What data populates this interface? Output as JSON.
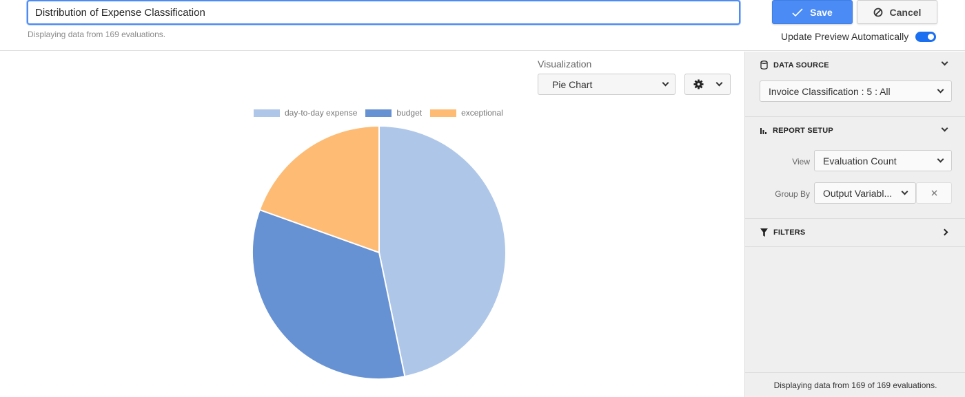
{
  "header": {
    "title_value": "Distribution of Expense Classification",
    "subtitle": "Displaying data from 169 evaluations.",
    "save_label": "Save",
    "cancel_label": "Cancel",
    "auto_update_label": "Update Preview Automatically",
    "auto_update_on": true
  },
  "visualization": {
    "label": "Visualization",
    "selected": "Pie Chart"
  },
  "sidebar": {
    "data_source": {
      "title": "DATA SOURCE",
      "selected": "Invoice Classification : 5 : All"
    },
    "report_setup": {
      "title": "REPORT SETUP",
      "view_label": "View",
      "view_value": "Evaluation Count",
      "group_by_label": "Group By",
      "group_by_value": "Output Variabl..."
    },
    "filters": {
      "title": "FILTERS"
    },
    "footer": "Displaying data from 169 of 169 evaluations."
  },
  "colors": {
    "accent": "#4a8bf5",
    "day_to_day": "#aec6e8",
    "budget": "#6692d4",
    "exceptional": "#fdbb74"
  },
  "chart_data": {
    "type": "pie",
    "title": "",
    "start_angle_deg": 0,
    "direction": "clockwise",
    "legend_position": "top",
    "categories": [
      "day-to-day expense",
      "budget",
      "exceptional"
    ],
    "values": [
      79,
      57,
      33
    ],
    "colors": [
      "#aec6e8",
      "#6692d4",
      "#fdbb74"
    ]
  }
}
